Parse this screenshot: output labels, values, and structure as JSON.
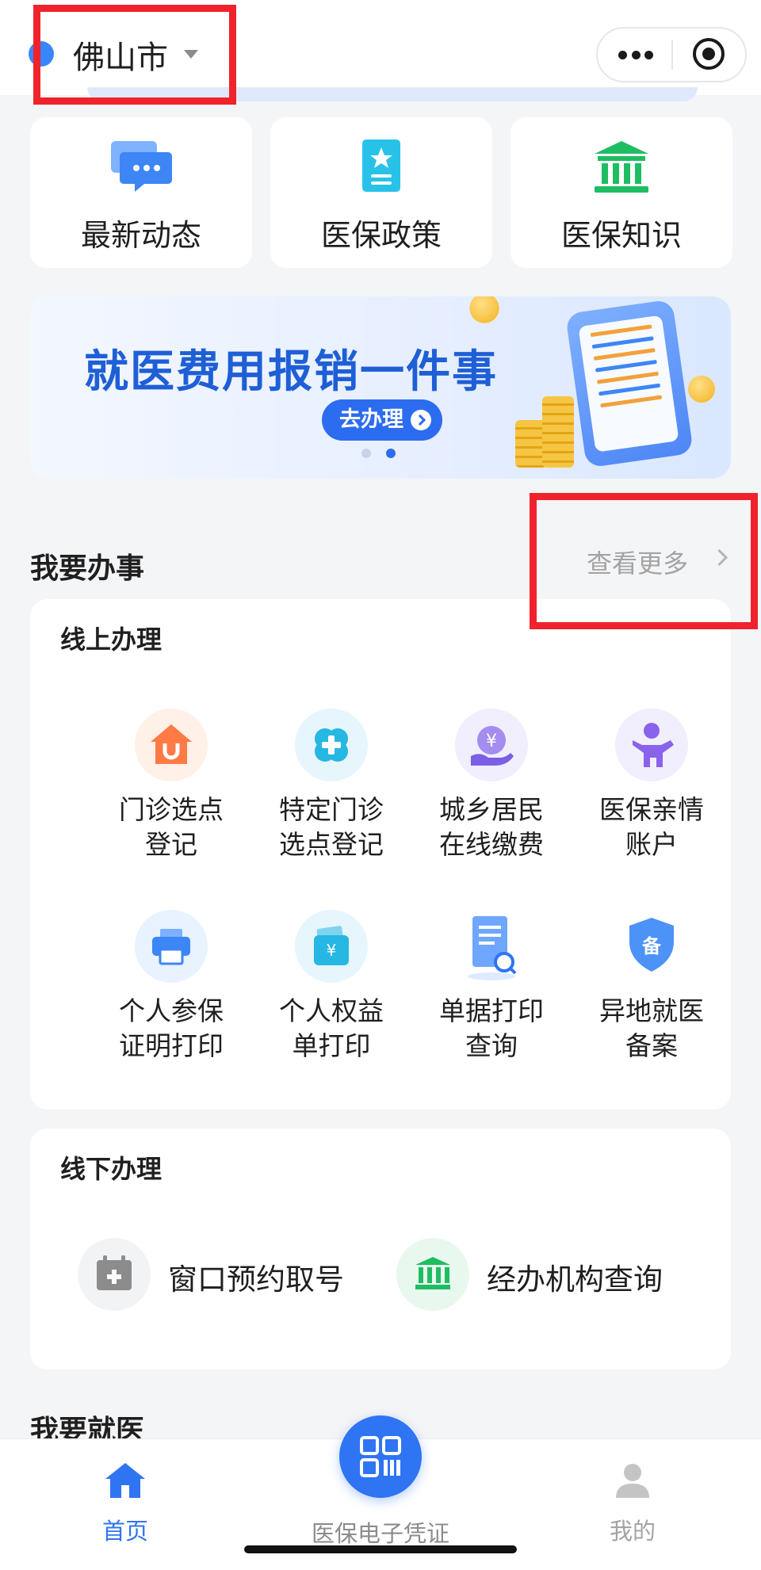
{
  "header": {
    "city": "佛山市"
  },
  "quick_links": [
    {
      "label": "最新动态",
      "icon": "message-bubble-icon"
    },
    {
      "label": "医保政策",
      "icon": "policy-document-icon"
    },
    {
      "label": "医保知识",
      "icon": "institution-building-icon"
    }
  ],
  "banner": {
    "title": "就医费用报销一件事",
    "button_label": "去办理",
    "page_count": 2,
    "active_index": 1
  },
  "services": {
    "title": "我要办事",
    "more_label": "查看更多",
    "online": {
      "title": "线上办理",
      "items": [
        {
          "line1": "门诊选点",
          "line2": "登记",
          "icon": "house-clinic-icon"
        },
        {
          "line1": "特定门诊",
          "line2": "选点登记",
          "icon": "medical-cross-icon"
        },
        {
          "line1": "城乡居民",
          "line2": "在线缴费",
          "icon": "yuan-payment-icon"
        },
        {
          "line1": "医保亲情",
          "line2": "账户",
          "icon": "family-person-icon"
        },
        {
          "line1": "个人参保",
          "line2": "证明打印",
          "icon": "printer-icon"
        },
        {
          "line1": "个人权益",
          "line2": "单打印",
          "icon": "yuan-wallet-icon"
        },
        {
          "line1": "单据打印",
          "line2": "查询",
          "icon": "receipt-search-icon"
        },
        {
          "line1": "异地就医",
          "line2": "备案",
          "icon": "filing-shield-icon"
        }
      ]
    },
    "offline": {
      "title": "线下办理",
      "items": [
        {
          "label": "窗口预约取号",
          "icon": "calendar-add-icon"
        },
        {
          "label": "经办机构查询",
          "icon": "institution-building-icon"
        }
      ]
    }
  },
  "next_section": {
    "title": "我要就医"
  },
  "tabbar": {
    "home": "首页",
    "ecard": "医保电子凭证",
    "mine": "我的"
  },
  "colors": {
    "brand_blue": "#2f74f3",
    "highlight_red": "#f0232d"
  }
}
